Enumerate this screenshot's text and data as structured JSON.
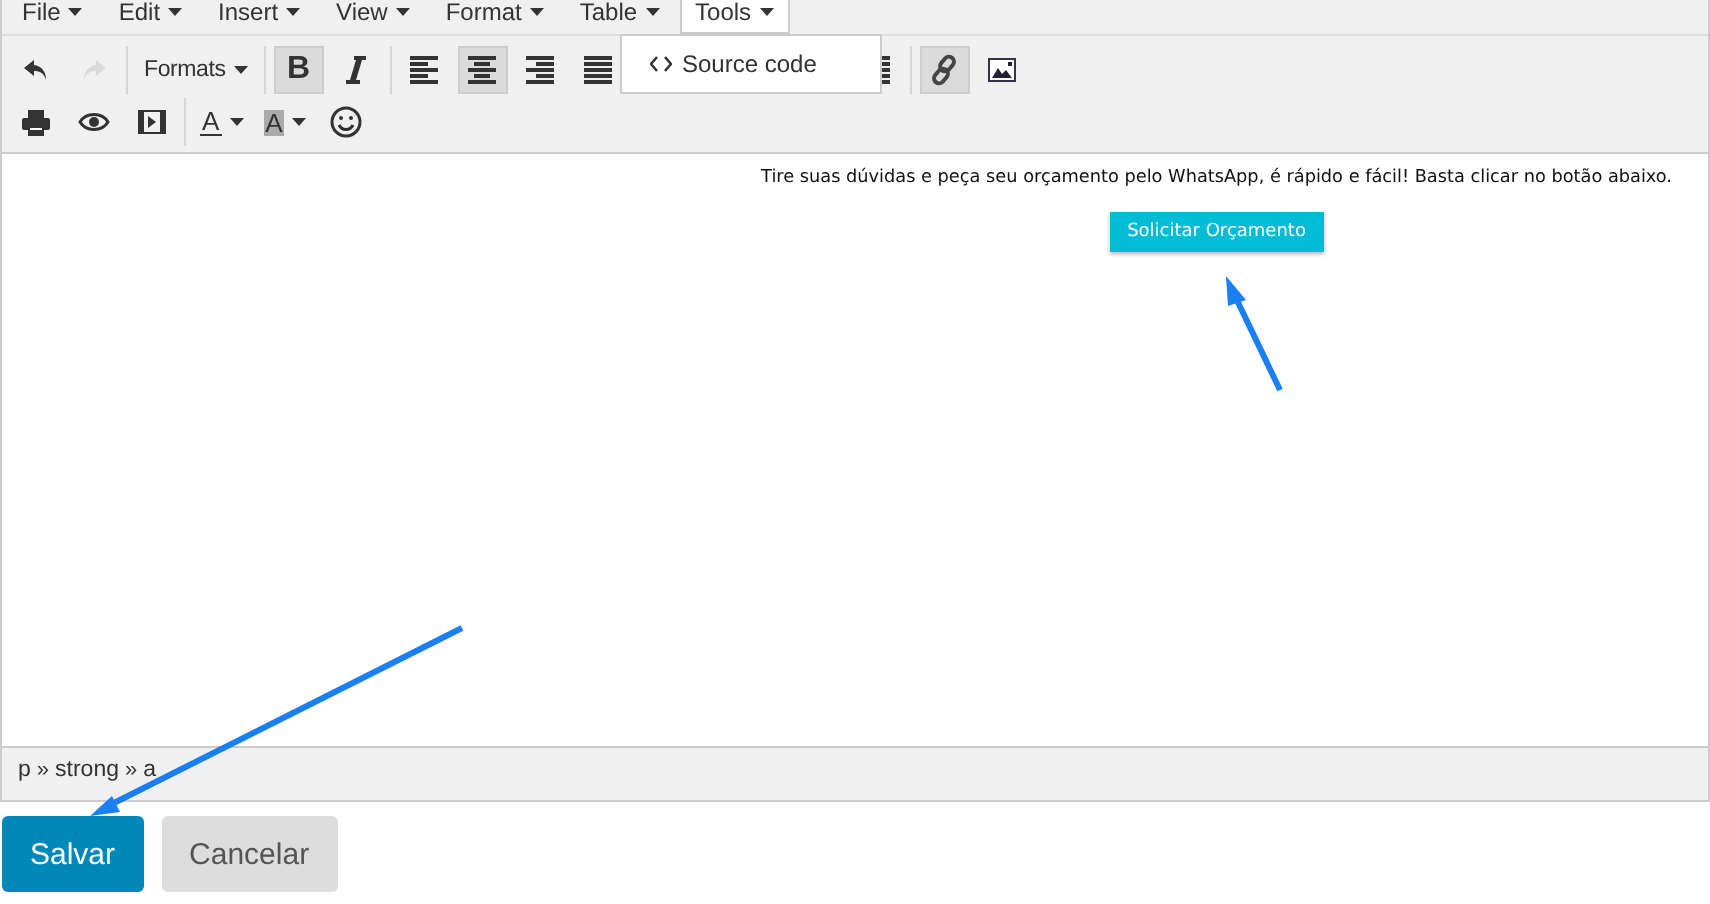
{
  "menubar": [
    {
      "label": "File",
      "selected": false
    },
    {
      "label": "Edit",
      "selected": false
    },
    {
      "label": "Insert",
      "selected": false
    },
    {
      "label": "View",
      "selected": false
    },
    {
      "label": "Format",
      "selected": false
    },
    {
      "label": "Table",
      "selected": false
    },
    {
      "label": "Tools",
      "selected": true
    }
  ],
  "open_menu": {
    "items": [
      {
        "label": "Source code"
      }
    ]
  },
  "toolbar": [
    [
      [
        {
          "kind": "undo",
          "active": false,
          "disabled": false
        },
        {
          "kind": "redo",
          "active": false,
          "disabled": true
        }
      ],
      [
        {
          "kind": "formats",
          "label": "Formats",
          "active": false,
          "disabled": false
        }
      ],
      [
        {
          "kind": "bold",
          "label": "B",
          "active": true,
          "disabled": false
        },
        {
          "kind": "italic",
          "active": false,
          "disabled": false
        }
      ],
      [
        {
          "kind": "align-left",
          "active": false,
          "disabled": false
        },
        {
          "kind": "align-center",
          "active": true,
          "disabled": false
        },
        {
          "kind": "align-right",
          "active": false,
          "disabled": false
        },
        {
          "kind": "justify",
          "active": false,
          "disabled": false
        },
        {
          "kind": "list",
          "active": false,
          "disabled": false
        }
      ],
      [
        {
          "kind": "link",
          "active": true,
          "disabled": false
        },
        {
          "kind": "image",
          "active": false,
          "disabled": false
        }
      ]
    ],
    [
      [
        {
          "kind": "print",
          "active": false,
          "disabled": false
        },
        {
          "kind": "preview",
          "active": false,
          "disabled": false
        },
        {
          "kind": "media",
          "active": false,
          "disabled": false
        }
      ],
      [
        {
          "kind": "text-color",
          "label": "A",
          "active": false,
          "disabled": false
        },
        {
          "kind": "background-color",
          "label": "A",
          "active": false,
          "disabled": false
        },
        {
          "kind": "emoticons",
          "active": false,
          "disabled": false
        }
      ]
    ]
  ],
  "content": {
    "paragraph": "Tire suas dúvidas e peça seu orçamento pelo WhatsApp, é rápido e fácil! Basta clicar no botão abaixo.",
    "button": "Solicitar Orçamento"
  },
  "statusbar": {
    "path": [
      "p",
      "strong",
      "a"
    ],
    "separator": "»"
  },
  "actions": [
    {
      "label": "Salvar",
      "kind": "primary"
    },
    {
      "label": "Cancelar",
      "kind": "secondary"
    }
  ]
}
